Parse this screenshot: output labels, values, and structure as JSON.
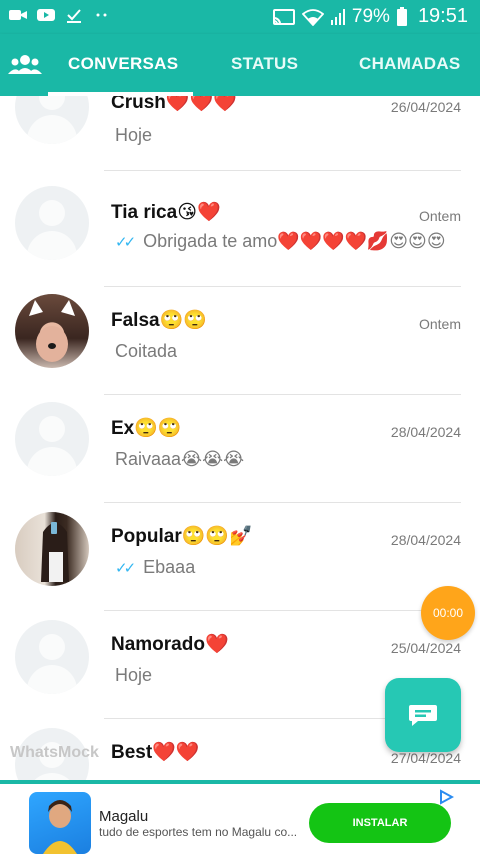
{
  "status_bar": {
    "battery": "79%",
    "time": "19:51",
    "icons": [
      "video-icon",
      "youtube-icon",
      "download-icon",
      "dots-icon",
      "cast-icon",
      "wifi-icon",
      "signal-icon",
      "battery-icon"
    ]
  },
  "tabs": {
    "conversas": "CONVERSAS",
    "status": "STATUS",
    "chamadas": "CHAMADAS"
  },
  "chats": [
    {
      "name": "Crush❤️❤️❤️",
      "date": "26/04/2024",
      "message": "Hoje",
      "ticks": false
    },
    {
      "name": "Tia rica😘❤️",
      "date": "Ontem",
      "message": "Obrigada te amo❤️❤️❤️❤️💋😍😍😍",
      "ticks": true
    },
    {
      "name": "Falsa🙄🙄",
      "date": "Ontem",
      "message": "Coitada",
      "ticks": false
    },
    {
      "name": "Ex🙄🙄",
      "date": "28/04/2024",
      "message": "Raivaaa😭😭😭",
      "ticks": false
    },
    {
      "name": "Popular🙄🙄💅",
      "date": "28/04/2024",
      "message": "Ebaaa",
      "ticks": true
    },
    {
      "name": "Namorado❤️",
      "date": "25/04/2024",
      "message": "Hoje",
      "ticks": false
    },
    {
      "name": "Best❤️❤️",
      "date": "27/04/2024",
      "message": "",
      "ticks": false
    }
  ],
  "tick_glyph": "✓✓",
  "timer": "00:00",
  "watermark": "WhatsMock",
  "ad": {
    "title": "Magalu",
    "subtitle": "tudo de esportes tem no Magalu co...",
    "button": "INSTALAR"
  },
  "colors": {
    "header": "#1ab8a6",
    "fab": "#26c8b4",
    "timer": "#ffa51a",
    "install": "#14c414",
    "ticks": "#34b7f1"
  }
}
